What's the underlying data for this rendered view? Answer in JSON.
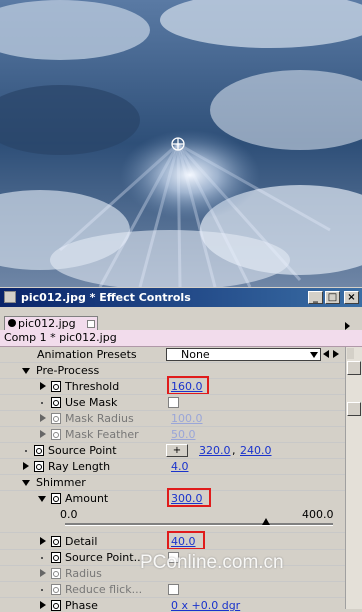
{
  "window": {
    "title": "pic012.jpg * Effect Controls",
    "tab_label": "pic012.jpg",
    "comp_label": "Comp 1 * pic012.jpg"
  },
  "presets": {
    "label": "Animation Presets",
    "value": "None"
  },
  "rows": {
    "pre_process": "Pre-Process",
    "threshold": {
      "label": "Threshold",
      "value": "160.0"
    },
    "use_mask": {
      "label": "Use Mask"
    },
    "mask_radius": {
      "label": "Mask Radius",
      "value": "100.0"
    },
    "mask_feather": {
      "label": "Mask Feather",
      "value": "50.0"
    },
    "source_point": {
      "label": "Source Point",
      "x": "320.0",
      "sep": ",",
      "y": "240.0"
    },
    "ray_length": {
      "label": "Ray Length",
      "value": "4.0"
    },
    "shimmer": "Shimmer",
    "amount": {
      "label": "Amount",
      "value": "300.0",
      "slider_min": "0.0",
      "slider_max": "400.0",
      "slider_fraction": 0.75
    },
    "detail": {
      "label": "Detail",
      "value": "40.0"
    },
    "source_point2": {
      "label": "Source Point..."
    },
    "radius": {
      "label": "Radius"
    },
    "reduce_flick": {
      "label": "Reduce flick..."
    },
    "phase": {
      "label": "Phase",
      "value": "0 x +0.0 dgr"
    }
  },
  "watermark": "PConline.com.cn",
  "colors": {
    "accent_red": "#e01b1b",
    "value_blue": "#1a33cc",
    "header_pink": "#f2dcec"
  }
}
